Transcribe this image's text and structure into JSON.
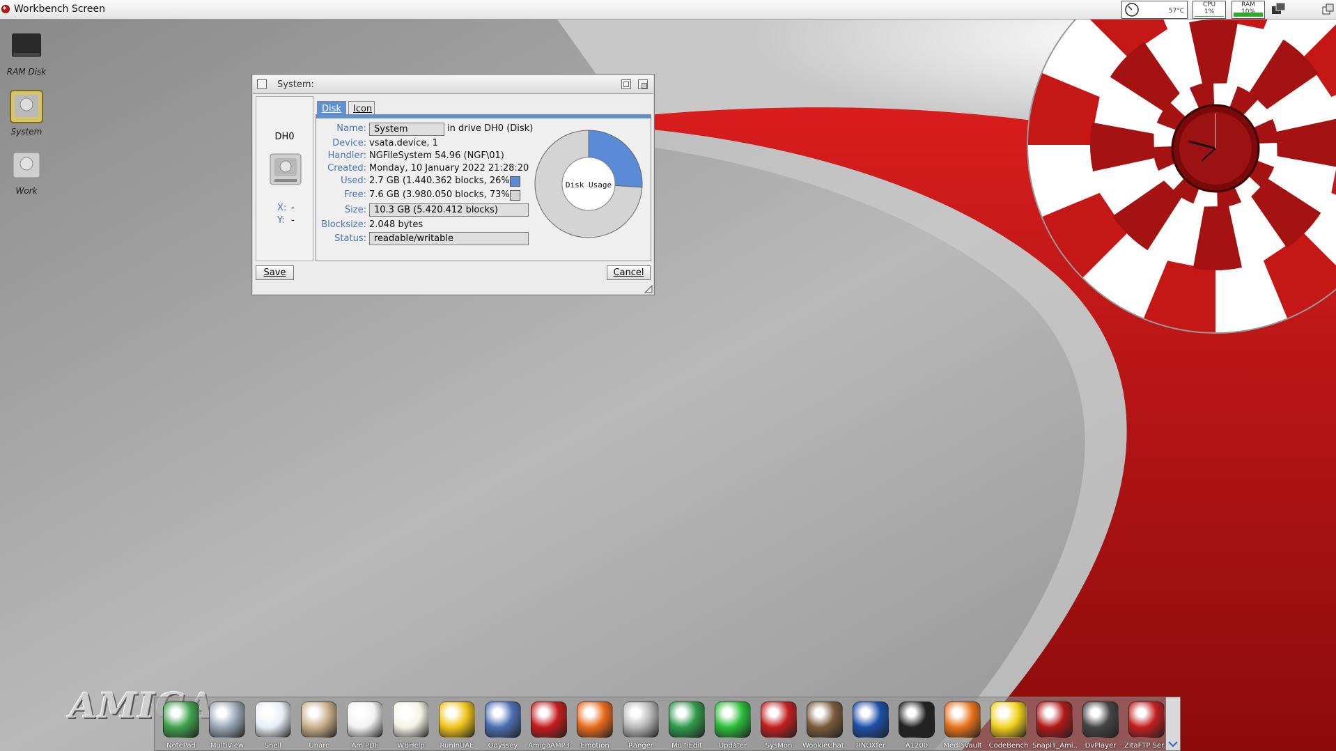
{
  "topbar": {
    "title": "Workbench Screen",
    "temp": "57°C",
    "cpu_label": "CPU",
    "cpu_value": "1%",
    "ram_label": "RAM",
    "ram_value": "10%",
    "cpu_level": 0.01,
    "ram_level": 0.1
  },
  "desktop_icons": [
    {
      "label": "RAM Disk",
      "icon": "ram-disk-icon"
    },
    {
      "label": "System",
      "icon": "hard-drive-icon"
    },
    {
      "label": "Work",
      "icon": "hard-drive-icon"
    }
  ],
  "window": {
    "title": "System:",
    "drive_name": "DH0",
    "x_label": "X:",
    "x_value": "-",
    "y_label": "Y:",
    "y_value": "-",
    "tabs": [
      {
        "label": "Disk",
        "active": true
      },
      {
        "label": "Icon",
        "active": false
      }
    ],
    "fields": {
      "name_label": "Name:",
      "name_value": "System",
      "name_suffix": "in drive DH0 (Disk)",
      "device_label": "Device:",
      "device_value": "vsata.device, 1",
      "handler_label": "Handler:",
      "handler_value": "NGFileSystem 54.96 (NGF\\01)",
      "created_label": "Created:",
      "created_value": "Monday, 10 January 2022 21:28:20",
      "used_label": "Used:",
      "used_value": "2.7 GB (1.440.362 blocks, 26%)",
      "free_label": "Free:",
      "free_value": "7.6 GB (3.980.050 blocks, 73%)",
      "size_label": "Size:",
      "size_value": "10.3 GB (5.420.412 blocks)",
      "blocksize_label": "Blocksize:",
      "blocksize_value": "2.048 bytes",
      "status_label": "Status:",
      "status_value": "readable/writable"
    },
    "chart_label": "Disk Usage",
    "used_color": "#5b8bd6",
    "free_color": "#d4d4d4",
    "save_label": "Save",
    "cancel_label": "Cancel"
  },
  "chart_data": {
    "type": "pie",
    "title": "Disk Usage",
    "categories": [
      "Used",
      "Free"
    ],
    "values": [
      26,
      74
    ]
  },
  "dock": {
    "items": [
      {
        "label": "NotePad",
        "color": "#3fa34d"
      },
      {
        "label": "MultiView",
        "color": "#9aa6b5"
      },
      {
        "label": "Shell",
        "color": "#e8eef6"
      },
      {
        "label": "Unarc",
        "color": "#c9b089"
      },
      {
        "label": "AmiPDF",
        "color": "#f2f2f2"
      },
      {
        "label": "WBHelp",
        "color": "#f3f3e8"
      },
      {
        "label": "RunInUAE",
        "color": "#f0c419"
      },
      {
        "label": "Odyssey",
        "color": "#4a6fb3"
      },
      {
        "label": "AmigaAMP3",
        "color": "#c41c1c"
      },
      {
        "label": "Emotion",
        "color": "#e86a1c"
      },
      {
        "label": "Ranger",
        "color": "#b8b8b8"
      },
      {
        "label": "MultiEdit",
        "color": "#2f9a4a"
      },
      {
        "label": "Updater",
        "color": "#2bbd3a"
      },
      {
        "label": "SysMon",
        "color": "#c21e1e"
      },
      {
        "label": "WookieChat...",
        "color": "#7a5a3a"
      },
      {
        "label": "RNOXfer",
        "color": "#1c4fa8"
      },
      {
        "label": "A1200",
        "color": "#222222"
      },
      {
        "label": "MediaVault",
        "color": "#e8731a"
      },
      {
        "label": "CodeBench",
        "color": "#f1d21c"
      },
      {
        "label": "SnapIT_Ami...",
        "color": "#b01818"
      },
      {
        "label": "DvPlayer",
        "color": "#444444"
      },
      {
        "label": "ZitaFTP Ser...",
        "color": "#c21e1e"
      }
    ]
  },
  "branding": {
    "amiga_text": "AMIGA"
  }
}
